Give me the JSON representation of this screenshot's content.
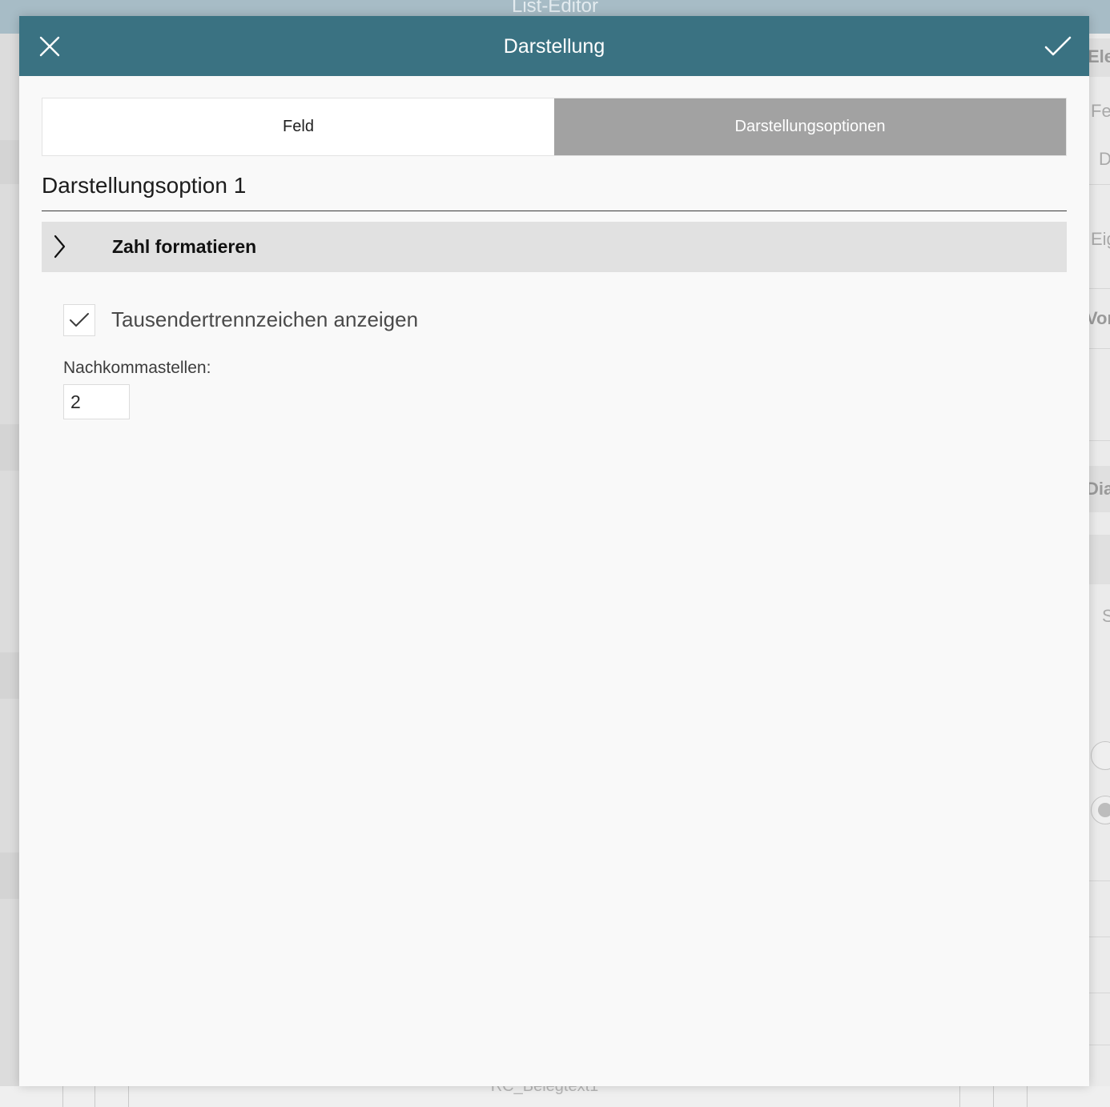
{
  "background": {
    "app_title": "List-Editor",
    "peek_texts": [
      "Ele",
      "Fe",
      "D",
      "Eig",
      "Vor",
      "Dia",
      "S"
    ],
    "bottom_text": "RC_Belegtext1"
  },
  "dialog": {
    "title": "Darstellung",
    "close_icon": "close-icon",
    "confirm_icon": "checkmark-icon",
    "header_color": "#3a7282"
  },
  "tabs": [
    {
      "label": "Feld",
      "active": false
    },
    {
      "label": "Darstellungsoptionen",
      "active": true
    }
  ],
  "section": {
    "title": "Darstellungsoption 1",
    "accordion": {
      "label": "Zahl formatieren",
      "icon": "chevron-right-icon",
      "expanded": true
    },
    "checkbox": {
      "label": "Tausendertrennzeichen anzeigen",
      "checked": true
    },
    "decimal_places": {
      "label": "Nachkommastellen:",
      "value": "2"
    }
  }
}
